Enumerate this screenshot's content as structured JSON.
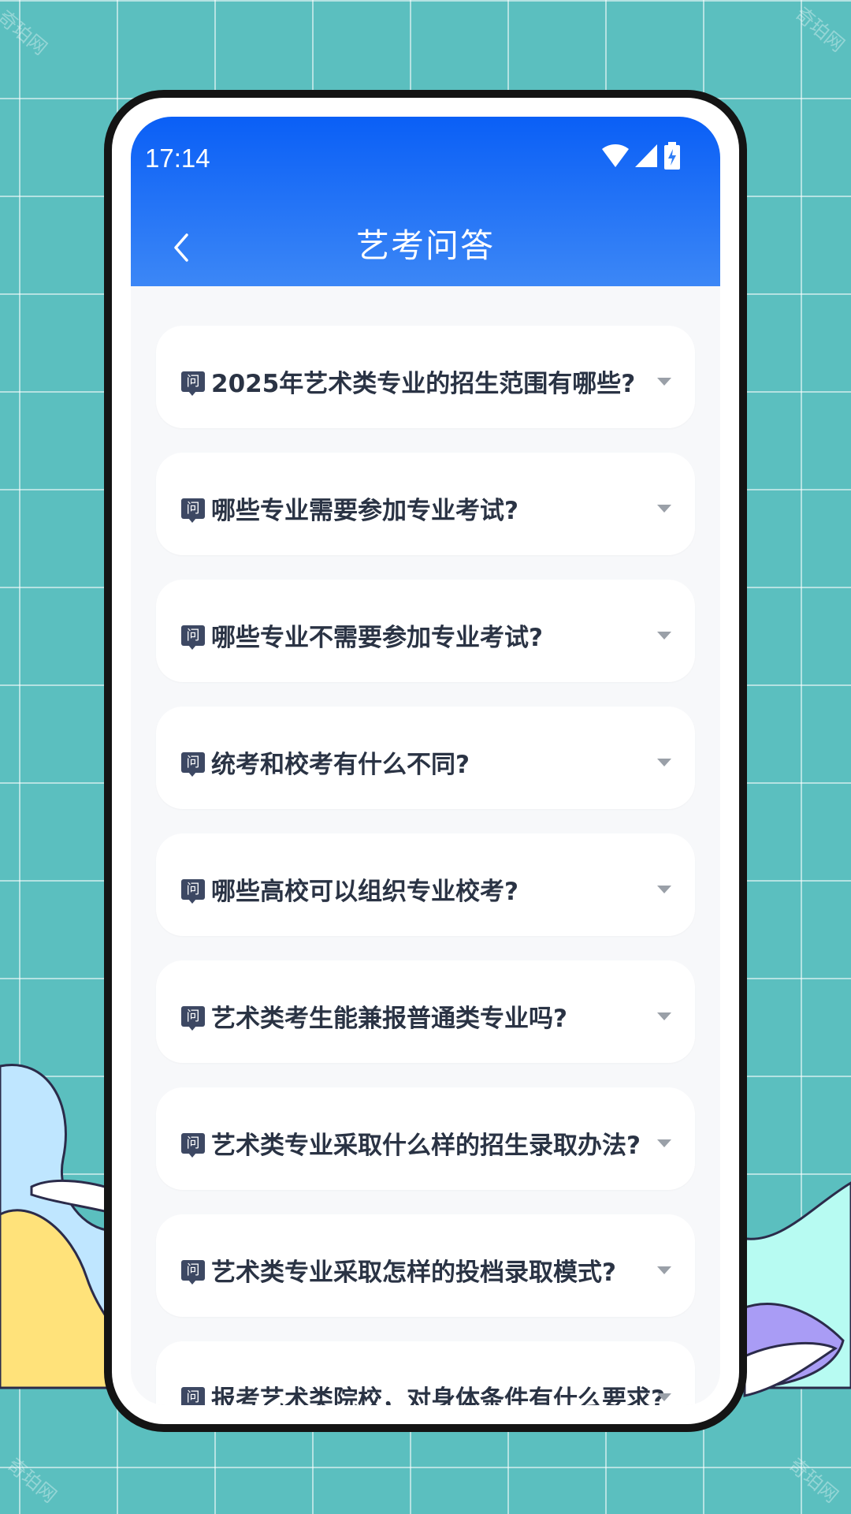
{
  "status_bar": {
    "time": "17:14",
    "icons": [
      "wifi-icon",
      "signal-icon",
      "battery-charging-icon"
    ]
  },
  "header": {
    "title": "艺考问答",
    "back_icon": "chevron-left-icon"
  },
  "badge_label": "问",
  "questions": [
    "2025年艺术类专业的招生范围有哪些?",
    "哪些专业需要参加专业考试?",
    "哪些专业不需要参加专业考试?",
    "统考和校考有什么不同?",
    "哪些高校可以组织专业校考?",
    "艺术类考生能兼报普通类专业吗?",
    "艺术类专业采取什么样的招生录取办法?",
    "艺术类专业采取怎样的投档录取模式?",
    "报考艺术类院校，对身体条件有什么要求?"
  ],
  "watermark": "奇珀网",
  "colors": {
    "background": "#5bbfbf",
    "header_top": "#0a5ff6",
    "header_bottom": "#3c87f6",
    "badge": "#3d4863",
    "question_text": "#2a3344"
  }
}
